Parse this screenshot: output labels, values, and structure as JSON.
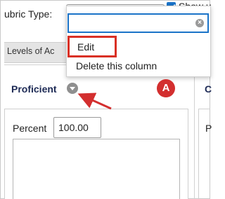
{
  "rubric": {
    "type_label": "ubric Type:",
    "show_label": "Show u"
  },
  "tabs": {
    "levels_label": "Levels of Ac"
  },
  "column": {
    "title": "Proficient",
    "next_title": "C",
    "menu_icon": "chevron-down-circle-icon"
  },
  "cell": {
    "percent_label": "Percent",
    "percent_value": "100.00",
    "next_percent_label": "P"
  },
  "menu": {
    "search_value": "",
    "items": [
      {
        "label": "Edit",
        "highlighted": true
      },
      {
        "label": "Delete this column",
        "highlighted": false
      }
    ]
  },
  "annotation": {
    "marker_label": "A",
    "marker_color": "#d32f2f",
    "highlight_color": "#d93025"
  },
  "colors": {
    "accent": "#1a73c8",
    "heading": "#1d2a55"
  }
}
